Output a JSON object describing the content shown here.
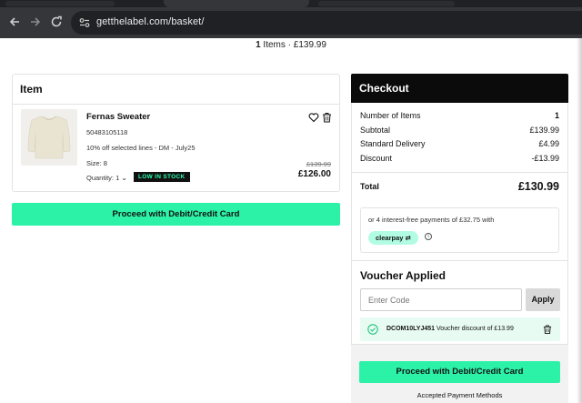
{
  "browser": {
    "url": "getthelabel.com/basket/",
    "back_icon": "arrow-left-icon",
    "forward_icon": "arrow-right-icon",
    "reload_icon": "reload-icon"
  },
  "summary": {
    "count": "1",
    "rest": " Items · £139.99"
  },
  "item_panel": {
    "heading": "Item",
    "product": {
      "name": "Fernas Sweater",
      "sku": "50483105118",
      "offer": "10% off selected lines - DM - July25",
      "size": "Size: 8",
      "quantity_label": "Quantity: 1",
      "stock_badge": "LOW IN STOCK",
      "old_price": "£139.99",
      "new_price": "£126.00"
    },
    "proceed_label": "Proceed with Debit/Credit Card"
  },
  "checkout": {
    "heading": "Checkout",
    "rows": [
      {
        "label": "Number of Items",
        "value": "1"
      },
      {
        "label": "Subtotal",
        "value": "£139.99"
      },
      {
        "label": "Standard Delivery",
        "value": "£4.99"
      },
      {
        "label": "Discount",
        "value": "-£13.99"
      }
    ],
    "total_label": "Total",
    "total_value": "£130.99",
    "clearpay_text": "or 4 interest-free payments of £32.75 with",
    "clearpay_badge": "clearpay",
    "voucher": {
      "heading": "Voucher Applied",
      "placeholder": "Enter Code",
      "apply_label": "Apply",
      "code": "DCOM10LYJ451",
      "discount_text": " Voucher discount of £13.99"
    },
    "proceed_label": "Proceed with Debit/Credit Card",
    "accepted_label": "Accepted Payment Methods"
  },
  "colors": {
    "accent_green": "#2cf2a8",
    "stock_text": "#2bffb0",
    "checkout_header": "#0b0b0b",
    "clearpay_badge": "#b2fce4"
  }
}
